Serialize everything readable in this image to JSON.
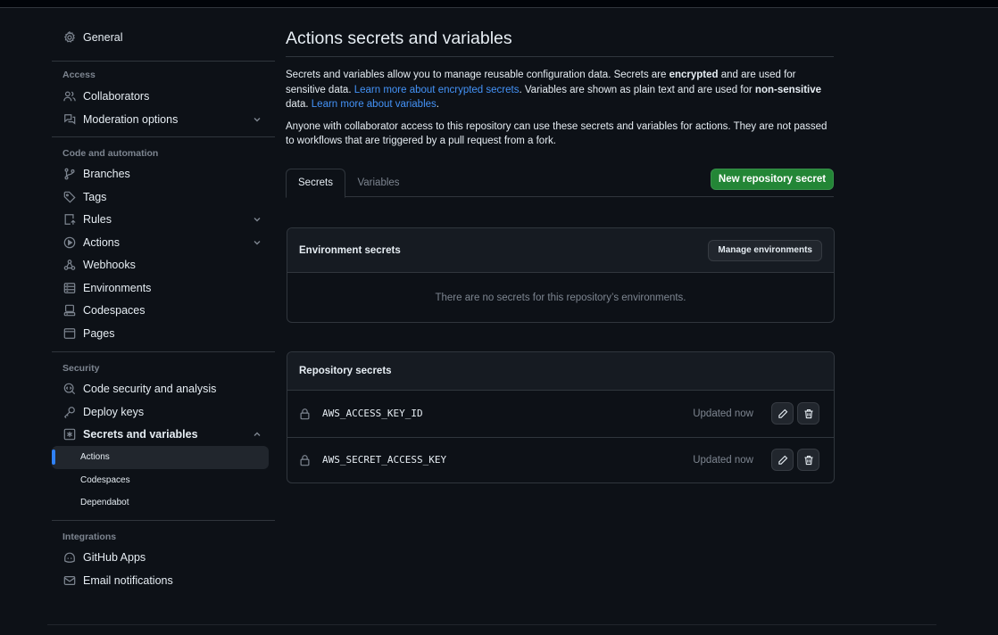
{
  "sidebar": {
    "general": "General",
    "access_header": "Access",
    "collaborators": "Collaborators",
    "moderation": "Moderation options",
    "code_header": "Code and automation",
    "branches": "Branches",
    "tags": "Tags",
    "rules": "Rules",
    "actions": "Actions",
    "webhooks": "Webhooks",
    "environments": "Environments",
    "codespaces": "Codespaces",
    "pages": "Pages",
    "security_header": "Security",
    "code_security": "Code security and analysis",
    "deploy_keys": "Deploy keys",
    "secrets_vars": "Secrets and variables",
    "sub_actions": "Actions",
    "sub_codespaces": "Codespaces",
    "sub_dependabot": "Dependabot",
    "integrations_header": "Integrations",
    "github_apps": "GitHub Apps",
    "email_notifications": "Email notifications"
  },
  "main": {
    "title": "Actions secrets and variables",
    "desc1_a": "Secrets and variables allow you to manage reusable configuration data. Secrets are ",
    "desc1_bold1": "encrypted",
    "desc1_b": " and are used for sensitive data. ",
    "desc1_link1": "Learn more about encrypted secrets",
    "desc1_c": ". Variables are shown as plain text and are used for ",
    "desc1_bold2": "non-sensitive",
    "desc1_d": " data. ",
    "desc1_link2": "Learn more about variables",
    "desc1_e": ".",
    "desc2": "Anyone with collaborator access to this repository can use these secrets and variables for actions. They are not passed to workflows that are triggered by a pull request from a fork.",
    "tabs": [
      {
        "label": "Secrets"
      },
      {
        "label": "Variables"
      }
    ],
    "new_secret_button": "New repository secret",
    "env_secrets": {
      "title": "Environment secrets",
      "manage_button": "Manage environments",
      "empty": "There are no secrets for this repository’s environments."
    },
    "repo_secrets": {
      "title": "Repository secrets",
      "rows": [
        {
          "name": "AWS_ACCESS_KEY_ID",
          "updated": "Updated now"
        },
        {
          "name": "AWS_SECRET_ACCESS_KEY",
          "updated": "Updated now"
        }
      ]
    }
  },
  "colors": {
    "background": "#0d1117",
    "accent_blue": "#2f81f7",
    "link_blue": "#4493f8",
    "primary_green": "#238636",
    "muted_text": "#7d8590"
  }
}
